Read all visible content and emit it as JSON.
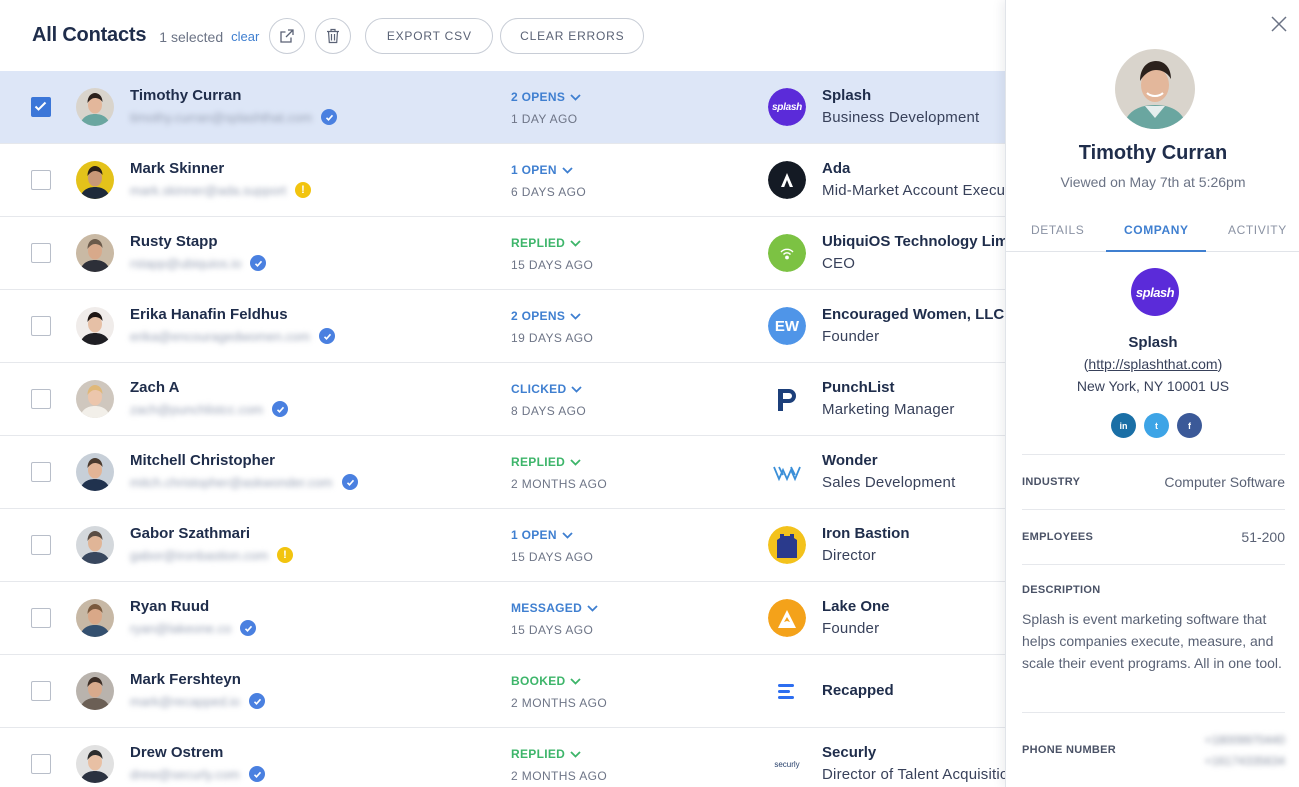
{
  "header": {
    "title": "All Contacts",
    "selected_text": "1 selected",
    "clear_label": "clear",
    "export_label": "EXPORT CSV",
    "clear_errors_label": "CLEAR ERRORS"
  },
  "contacts": [
    {
      "name": "Timothy Curran",
      "email": "timothy.curran@splashthat.com",
      "verify": "verified",
      "status": "2 OPENS",
      "status_color": "#3f7fd0",
      "ago": "1 DAY AGO",
      "company": "Splash",
      "role": "Business Development",
      "logo": "splash",
      "selected": true
    },
    {
      "name": "Mark Skinner",
      "email": "mark.skinner@ada.support",
      "verify": "warning",
      "status": "1 OPEN",
      "status_color": "#3f7fd0",
      "ago": "6 DAYS AGO",
      "company": "Ada",
      "role": "Mid-Market Account Executive",
      "logo": "ada",
      "selected": false
    },
    {
      "name": "Rusty Stapp",
      "email": "rstapp@ubiquios.io",
      "verify": "verified",
      "status": "REPLIED",
      "status_color": "#3db56a",
      "ago": "15 DAYS AGO",
      "company": "UbiquiOS Technology Limited",
      "role": "CEO",
      "logo": "ubiquios",
      "selected": false
    },
    {
      "name": "Erika Hanafin Feldhus",
      "email": "erika@encouragedwomen.com",
      "verify": "verified",
      "status": "2 OPENS",
      "status_color": "#3f7fd0",
      "ago": "19 DAYS AGO",
      "company": "Encouraged Women, LLC",
      "role": "Founder",
      "logo": "ew",
      "selected": false
    },
    {
      "name": "Zach A",
      "email": "zach@punchlistcc.com",
      "verify": "verified",
      "status": "CLICKED",
      "status_color": "#3f7fd0",
      "ago": "8 DAYS AGO",
      "company": "PunchList",
      "role": "Marketing Manager",
      "logo": "punchlist",
      "selected": false
    },
    {
      "name": "Mitchell Christopher",
      "email": "mitch.christopher@askwonder.com",
      "verify": "verified",
      "status": "REPLIED",
      "status_color": "#3db56a",
      "ago": "2 MONTHS AGO",
      "company": "Wonder",
      "role": "Sales Development",
      "logo": "wonder",
      "selected": false
    },
    {
      "name": "Gabor Szathmari",
      "email": "gabor@ironbastion.com",
      "verify": "warning",
      "status": "1 OPEN",
      "status_color": "#3f7fd0",
      "ago": "15 DAYS AGO",
      "company": "Iron Bastion",
      "role": "Director",
      "logo": "ironbastion",
      "selected": false
    },
    {
      "name": "Ryan Ruud",
      "email": "ryan@lakeone.co",
      "verify": "verified",
      "status": "MESSAGED",
      "status_color": "#3f7fd0",
      "ago": "15 DAYS AGO",
      "company": "Lake One",
      "role": "Founder",
      "logo": "lakeone",
      "selected": false
    },
    {
      "name": "Mark Fershteyn",
      "email": "mark@recapped.io",
      "verify": "verified",
      "status": "BOOKED",
      "status_color": "#3db56a",
      "ago": "2 MONTHS AGO",
      "company": "Recapped",
      "role": "",
      "logo": "recapped",
      "selected": false
    },
    {
      "name": "Drew Ostrem",
      "email": "drew@securly.com",
      "verify": "verified",
      "status": "REPLIED",
      "status_color": "#3db56a",
      "ago": "2 MONTHS AGO",
      "company": "Securly",
      "role": "Director of Talent Acquisition",
      "logo": "securly",
      "selected": false
    }
  ],
  "logo_text": {
    "splash": "splash",
    "ew": "EW",
    "securly": "securly"
  },
  "panel": {
    "name": "Timothy Curran",
    "viewed": "Viewed on May 7th at 5:26pm",
    "tabs": [
      "DETAILS",
      "COMPANY",
      "ACTIVITY"
    ],
    "active_tab": "COMPANY",
    "company": {
      "name": "Splash",
      "url": "http://splashthat.com",
      "address": "New York, NY 10001 US",
      "socials": [
        "in",
        "t",
        "f"
      ],
      "industry_label": "INDUSTRY",
      "industry": "Computer Software",
      "employees_label": "EMPLOYEES",
      "employees": "51-200",
      "description_label": "DESCRIPTION",
      "description": "Splash is event marketing software that helps companies execute, measure, and scale their event programs. All in one tool.",
      "phone_label": "PHONE NUMBER",
      "phone_1": "+18009970440",
      "phone_2": "+16174335634"
    }
  },
  "colors": {
    "accent": "#3f7fd0",
    "verified": "#4a80e0",
    "warning": "#f2c40f",
    "selected_row": "#dde6f7",
    "checkbox": "#3b76d8"
  }
}
